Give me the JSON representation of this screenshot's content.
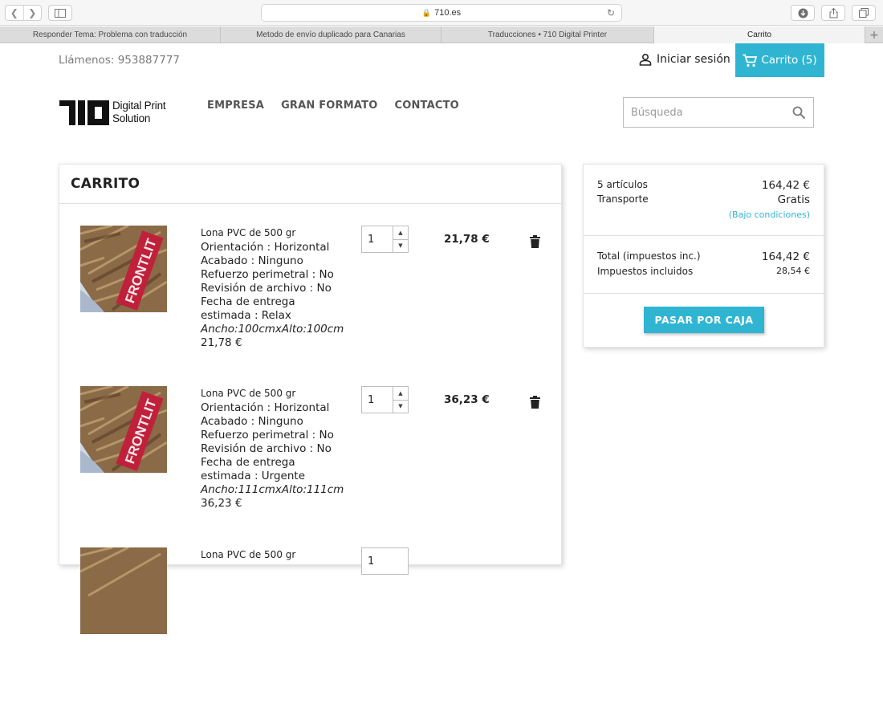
{
  "browser": {
    "url": "710.es",
    "tabs": [
      {
        "label": "Responder Tema: Problema con traducción",
        "active": false
      },
      {
        "label": "Metodo de envío duplicado para Canarias",
        "active": false
      },
      {
        "label": "Traducciones • 710 Digital Printer",
        "active": false
      },
      {
        "label": "Carrito",
        "active": true
      }
    ]
  },
  "header": {
    "phone": "Llámenos: 953887777",
    "login_label": "Iniciar sesión",
    "cart_label": "Carrito (5)",
    "logo_line1": "Digital Print",
    "logo_line2": "Solution",
    "menu": [
      "EMPRESA",
      "GRAN FORMATO",
      "CONTACTO"
    ],
    "search_placeholder": "Búsqueda"
  },
  "cart": {
    "title": "CARRITO",
    "items": [
      {
        "name": "Lona PVC de 500 gr",
        "attributes": [
          "Orientación : Horizontal",
          "Acabado : Ninguno",
          "Refuerzo perimetral : No",
          "Revisión de archivo : No",
          "Fecha de entrega estimada : Relax"
        ],
        "dimensions": "Ancho:100cmxAlto:100cm",
        "unit_price": "21,78 €",
        "quantity": "1",
        "total": "21,78 €"
      },
      {
        "name": "Lona PVC de 500 gr",
        "attributes": [
          "Orientación : Horizontal",
          "Acabado : Ninguno",
          "Refuerzo perimetral : No",
          "Revisión de archivo : No",
          "Fecha de entrega estimada : Urgente"
        ],
        "dimensions": "Ancho:111cmxAlto:111cm",
        "unit_price": "36,23 €",
        "quantity": "1",
        "total": "36,23 €"
      },
      {
        "name": "Lona PVC de 500 gr",
        "quantity": "1"
      }
    ]
  },
  "summary": {
    "items_label": "5 artículos",
    "items_value": "164,42 €",
    "shipping_label": "Transporte",
    "shipping_value": "Gratis",
    "conditions": "(Bajo condiciones)",
    "total_label": "Total (impuestos inc.)",
    "total_value": "164,42 €",
    "tax_label": "Impuestos incluidos",
    "tax_value": "28,54 €",
    "checkout_label": "PASAR POR CAJA"
  },
  "colors": {
    "accent": "#2fb5d2",
    "text": "#232323",
    "muted": "#7a7a7a"
  },
  "product_image_text": "FRONTLIT"
}
